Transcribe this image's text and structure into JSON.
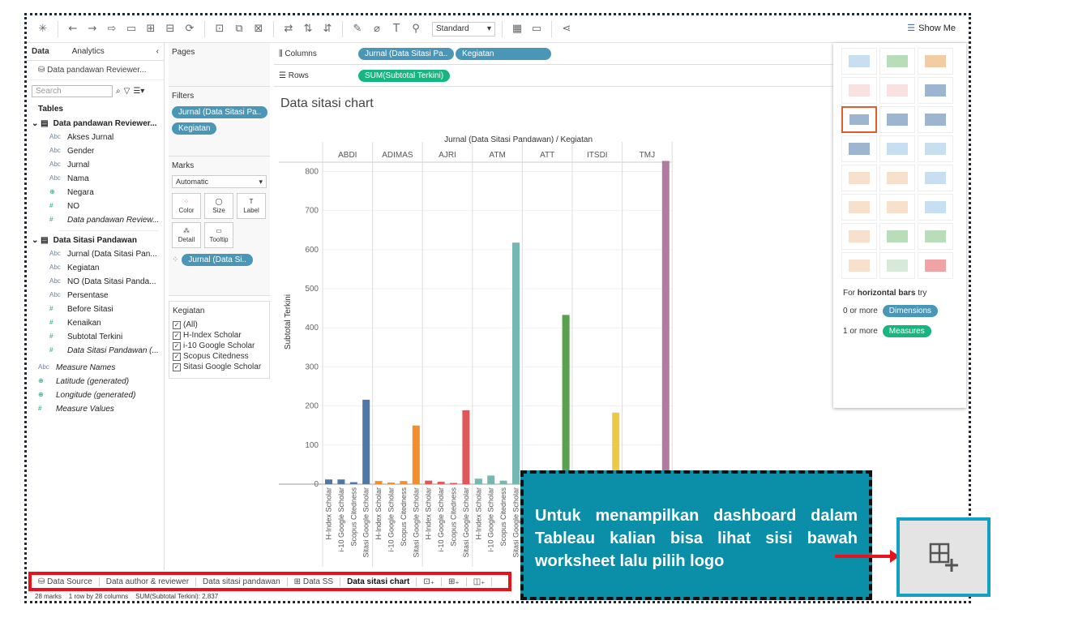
{
  "toolbar": {
    "fit_value": "Standard",
    "show_me_label": "Show Me"
  },
  "left_pane": {
    "tab_data": "Data",
    "tab_analytics": "Analytics",
    "datasource": "Data pandawan Reviewer...",
    "search_placeholder": "Search",
    "tables_label": "Tables",
    "table1": {
      "name": "Data pandawan Reviewer...",
      "fields": [
        {
          "type": "Abc",
          "name": "Akses Jurnal"
        },
        {
          "type": "Abc",
          "name": "Gender"
        },
        {
          "type": "Abc",
          "name": "Jurnal"
        },
        {
          "type": "Abc",
          "name": "Nama"
        },
        {
          "type": "globe",
          "name": "Negara"
        },
        {
          "type": "#",
          "name": "NO"
        },
        {
          "type": "#",
          "name": "Data pandawan Review..."
        }
      ]
    },
    "table2": {
      "name": "Data Sitasi Pandawan",
      "fields": [
        {
          "type": "Abc",
          "name": "Jurnal (Data Sitasi Pan..."
        },
        {
          "type": "Abc",
          "name": "Kegiatan"
        },
        {
          "type": "Abc",
          "name": "NO (Data Sitasi Panda..."
        },
        {
          "type": "Abc",
          "name": "Persentase"
        },
        {
          "type": "#",
          "name": "Before Sitasi"
        },
        {
          "type": "#",
          "name": "Kenaikan"
        },
        {
          "type": "#",
          "name": "Subtotal Terkini"
        },
        {
          "type": "#",
          "name": "Data Sitasi Pandawan (..."
        }
      ]
    },
    "extra_fields": [
      {
        "type": "Abc",
        "name": "Measure Names"
      },
      {
        "type": "globe",
        "name": "Latitude (generated)"
      },
      {
        "type": "globe",
        "name": "Longitude (generated)"
      },
      {
        "type": "#",
        "name": "Measure Values"
      }
    ]
  },
  "cards": {
    "pages": "Pages",
    "filters": "Filters",
    "filter_pills": [
      "Jurnal (Data Sitasi Pa..",
      "Kegiatan"
    ],
    "marks": "Marks",
    "marks_type": "Automatic",
    "mark_buttons": [
      "Color",
      "Size",
      "Label",
      "Detail",
      "Tooltip"
    ],
    "marks_pill": "Jurnal (Data Si..",
    "legend_title": "Kegiatan",
    "legend_items": [
      "(All)",
      "H-Index Scholar",
      "i-10 Google Scholar",
      "Scopus Citedness",
      "Sitasi Google Scholar"
    ]
  },
  "shelves": {
    "columns_label": "Columns",
    "columns_pills": [
      "Jurnal (Data Sitasi Pa..",
      "Kegiatan"
    ],
    "rows_label": "Rows",
    "rows_pills": [
      "SUM(Subtotal Terkini)"
    ]
  },
  "sheet_title": "Data sitasi chart",
  "chart_data": {
    "type": "bar",
    "header": "Jurnal (Data Sitasi Pandawan) / Kegiatan",
    "ylabel": "Subtotal Terkini",
    "ylim": [
      0,
      830
    ],
    "yticks": [
      0,
      100,
      200,
      300,
      400,
      500,
      600,
      700,
      800
    ],
    "subcategories": [
      "H-Index Scholar",
      "i-10 Google Scholar",
      "Scopus Citedness",
      "Sitasi Google Scholar"
    ],
    "groups": [
      {
        "name": "ABDI",
        "color": "#4e79a7",
        "values": [
          12,
          12,
          5,
          216
        ]
      },
      {
        "name": "ADIMAS",
        "color": "#f28e2b",
        "values": [
          8,
          4,
          8,
          150
        ]
      },
      {
        "name": "AJRI",
        "color": "#e15759",
        "values": [
          9,
          6,
          3,
          189
        ]
      },
      {
        "name": "ATM",
        "color": "#76b7b2",
        "values": [
          14,
          22,
          9,
          618
        ]
      },
      {
        "name": "ATT",
        "color": "#59a14f",
        "values": [
          9,
          27,
          8,
          433
        ]
      },
      {
        "name": "ITSDI",
        "color": "#edc948",
        "values": [
          16,
          6,
          3,
          183
        ]
      },
      {
        "name": "TMJ",
        "color": "#b07aa1",
        "values": [
          15,
          20,
          34,
          827
        ]
      }
    ]
  },
  "bottom_tabs": [
    "Data Source",
    "Data author & reviewer",
    "Data sitasi pandawan",
    "Data SS",
    "Data sitasi chart"
  ],
  "status": {
    "marks": "28 marks",
    "dims": "1 row by 28 columns",
    "sum": "SUM(Subtotal Terkini): 2,837"
  },
  "show_me": {
    "hint_prefix": "For ",
    "hint_bold": "horizontal bars",
    "hint_suffix": " try",
    "dim_text": "0 or more",
    "dim_pill": "Dimensions",
    "meas_text": "1 or more",
    "meas_pill": "Measures"
  },
  "callout": {
    "text": "Untuk menampilkan dashboard dalam Tableau kalian bisa lihat sisi bawah worksheet lalu pilih logo"
  }
}
